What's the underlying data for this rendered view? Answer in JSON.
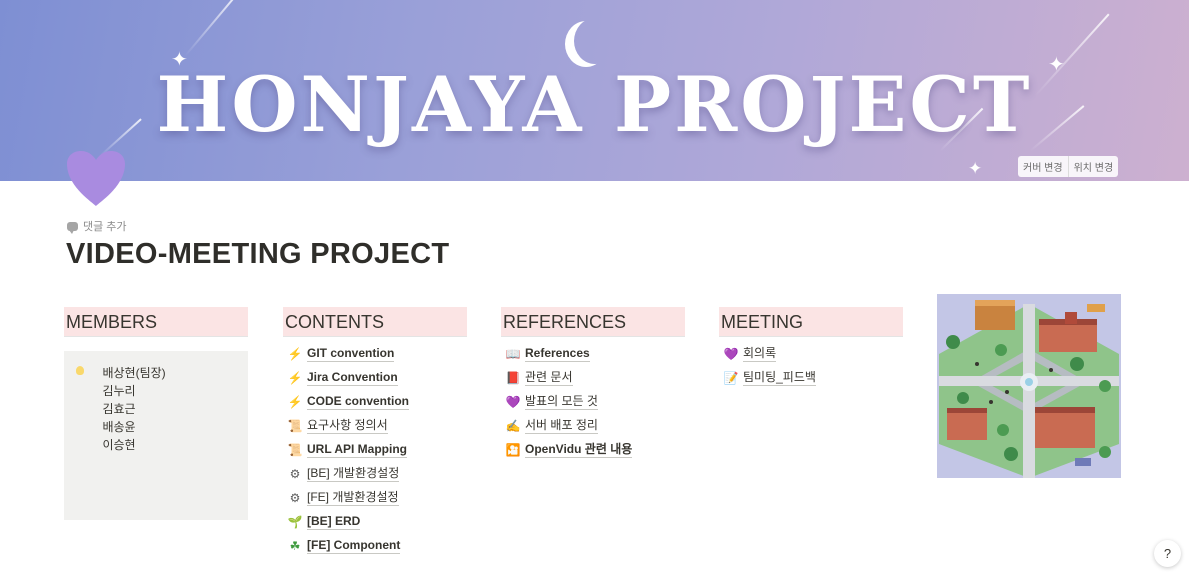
{
  "cover": {
    "title": "HONJAYA PROJECT",
    "change_cover": "커버 변경",
    "reposition": "위치 변경"
  },
  "page": {
    "icon": "purple-heart-icon",
    "add_comment": "댓글 추가",
    "title": "VIDEO-MEETING PROJECT"
  },
  "columns": {
    "members": {
      "heading": "MEMBERS",
      "icon": "lightbulb-icon",
      "people": [
        "배상현(팀장)",
        "김누리",
        "김효근",
        "배송윤",
        "이승현"
      ]
    },
    "contents": {
      "heading": "CONTENTS",
      "items": [
        {
          "icon": "lightning-icon",
          "glyph": "⚡",
          "label": "GIT convention"
        },
        {
          "icon": "lightning-icon",
          "glyph": "⚡",
          "label": "Jira Convention"
        },
        {
          "icon": "lightning-icon",
          "glyph": "⚡",
          "label": "CODE convention"
        },
        {
          "icon": "scroll-icon",
          "glyph": "📜",
          "label": "요구사항 정의서"
        },
        {
          "icon": "scroll-icon",
          "glyph": "📜",
          "label": "URL API Mapping"
        },
        {
          "icon": "gear-icon",
          "glyph": "⚙",
          "label": "[BE] 개발환경설정"
        },
        {
          "icon": "gear-icon",
          "glyph": "⚙",
          "label": "[FE] 개발환경설정"
        },
        {
          "icon": "seedling-icon",
          "glyph": "🌱",
          "label": "[BE] ERD"
        },
        {
          "icon": "clover-icon",
          "glyph": "☘",
          "label": "[FE] Component"
        }
      ]
    },
    "references": {
      "heading": "REFERENCES",
      "items": [
        {
          "icon": "book-icon",
          "glyph": "📖",
          "label": "References"
        },
        {
          "icon": "notebook-icon",
          "glyph": "📕",
          "label": "관련 문서"
        },
        {
          "icon": "purple-heart-icon",
          "glyph": "💜",
          "label": "발표의 모든 것"
        },
        {
          "icon": "pen-icon",
          "glyph": "✍",
          "label": "서버 배포 정리"
        },
        {
          "icon": "film-icon",
          "glyph": "🎦",
          "label": "OpenVidu 관련 내용"
        }
      ]
    },
    "meeting": {
      "heading": "MEETING",
      "items": [
        {
          "icon": "purple-heart-icon",
          "glyph": "💜",
          "label": "회의록"
        },
        {
          "icon": "memo-icon",
          "glyph": "📝",
          "label": "팀미팅_피드백"
        }
      ]
    }
  },
  "help": {
    "label": "?"
  },
  "colors": {
    "heading_bg": "#fbe4e4",
    "members_bg": "#f1f1ef",
    "heart": "#a98be0",
    "text": "#37352f"
  }
}
